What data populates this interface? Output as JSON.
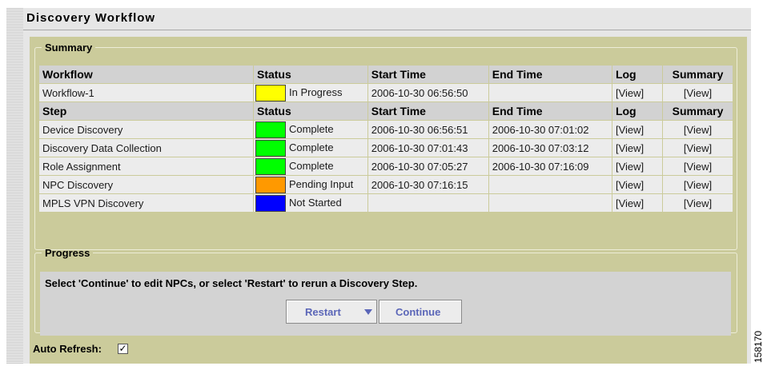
{
  "window": {
    "title": "Discovery Workflow"
  },
  "summary": {
    "legend": "Summary",
    "workflow_header": [
      "Workflow",
      "Status",
      "Start Time",
      "End Time",
      "Log",
      "Summary"
    ],
    "workflow": {
      "name": "Workflow-1",
      "status": "In Progress",
      "status_color": "#ffff00",
      "start": "2006-10-30 06:56:50",
      "end": "",
      "log": "[View]",
      "summary": "[View]"
    },
    "step_header": [
      "Step",
      "Status",
      "Start Time",
      "End Time",
      "Log",
      "Summary"
    ],
    "steps": [
      {
        "name": "Device Discovery",
        "status": "Complete",
        "status_color": "#00ff00",
        "start": "2006-10-30 06:56:51",
        "end": "2006-10-30 07:01:02",
        "log": "[View]",
        "summary": "[View]"
      },
      {
        "name": "Discovery Data Collection",
        "status": "Complete",
        "status_color": "#00ff00",
        "start": "2006-10-30 07:01:43",
        "end": "2006-10-30 07:03:12",
        "log": "[View]",
        "summary": "[View]"
      },
      {
        "name": "Role Assignment",
        "status": "Complete",
        "status_color": "#00ff00",
        "start": "2006-10-30 07:05:27",
        "end": "2006-10-30 07:16:09",
        "log": "[View]",
        "summary": "[View]"
      },
      {
        "name": "NPC Discovery",
        "status": "Pending Input",
        "status_color": "#ff9900",
        "start": "2006-10-30 07:16:15",
        "end": "",
        "log": "[View]",
        "summary": "[View]"
      },
      {
        "name": "MPLS VPN Discovery",
        "status": "Not Started",
        "status_color": "#0000ff",
        "start": "",
        "end": "",
        "log": "[View]",
        "summary": "[View]"
      }
    ]
  },
  "progress": {
    "legend": "Progress",
    "message": "Select 'Continue' to edit NPCs, or select 'Restart' to rerun a Discovery Step.",
    "restart_label": "Restart",
    "continue_label": "Continue"
  },
  "auto_refresh": {
    "label": "Auto Refresh:",
    "checked": true,
    "check_glyph": "✓"
  },
  "side_code": "158170",
  "colors": {
    "olive": "#cbcb9b",
    "link": "#5b66b8"
  }
}
